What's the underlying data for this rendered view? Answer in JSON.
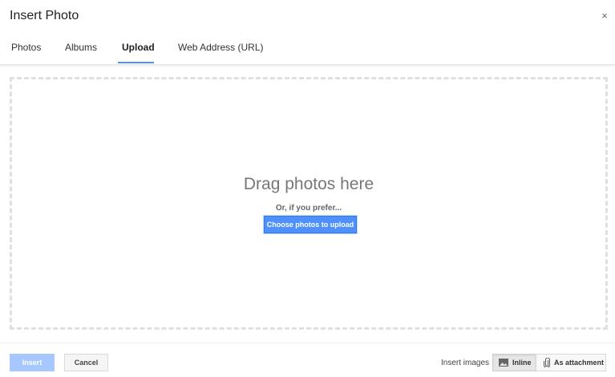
{
  "dialog": {
    "title": "Insert Photo",
    "close_glyph": "×"
  },
  "tabs": [
    {
      "label": "Photos",
      "active": false
    },
    {
      "label": "Albums",
      "active": false
    },
    {
      "label": "Upload",
      "active": true
    },
    {
      "label": "Web Address (URL)",
      "active": false
    }
  ],
  "upload": {
    "drag_title": "Drag photos here",
    "or_text": "Or, if you prefer...",
    "choose_button": "Choose photos to upload"
  },
  "footer": {
    "insert_button": "Insert",
    "cancel_button": "Cancel",
    "insert_images_label": "Insert images",
    "inline_option": "Inline",
    "attachment_option": "As attachment",
    "selected_option": "Inline"
  },
  "icons": {
    "close": "close-icon",
    "image": "image-icon",
    "paperclip": "paperclip-icon"
  },
  "colors": {
    "accent": "#4d90fe",
    "accent_disabled": "#a6c8ff",
    "dropzone_border": "#e0e0e0"
  }
}
